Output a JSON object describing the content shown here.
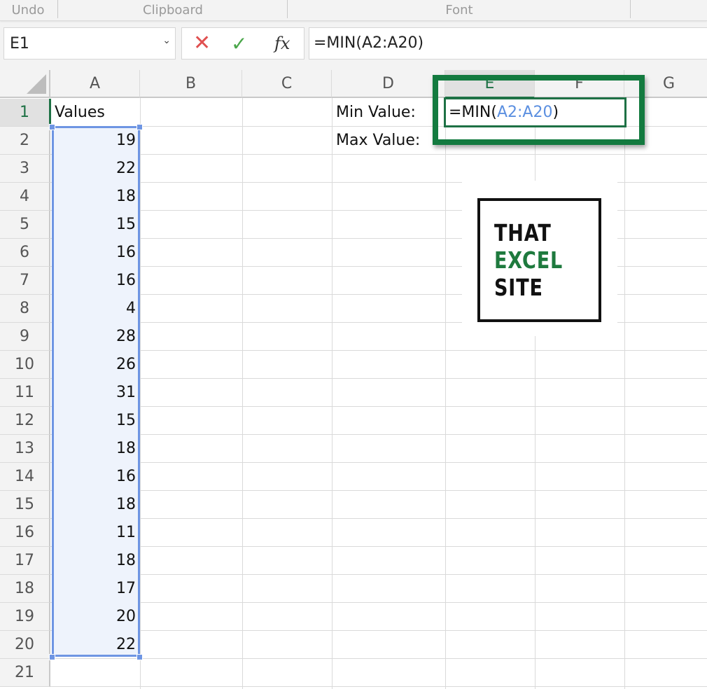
{
  "ribbon": {
    "groups": [
      "Undo",
      "Clipboard",
      "Font"
    ]
  },
  "name_box": {
    "value": "E1"
  },
  "formula_bar": {
    "cancel_icon": "x-icon",
    "enter_icon": "check-icon",
    "fx_label": "fx",
    "value": "=MIN(A2:A20)"
  },
  "columns": [
    "A",
    "B",
    "C",
    "D",
    "E",
    "F",
    "G"
  ],
  "rows": [
    "1",
    "2",
    "3",
    "4",
    "5",
    "6",
    "7",
    "8",
    "9",
    "10",
    "11",
    "12",
    "13",
    "14",
    "15",
    "16",
    "17",
    "18",
    "19",
    "20",
    "21"
  ],
  "cells": {
    "A1": "Values",
    "A_values": [
      "19",
      "22",
      "18",
      "15",
      "16",
      "16",
      "4",
      "28",
      "26",
      "31",
      "15",
      "18",
      "16",
      "18",
      "11",
      "18",
      "17",
      "20",
      "22"
    ],
    "D1": "Min Value:",
    "D2": "Max Value:"
  },
  "editing": {
    "cell": "E1",
    "prefix": "=MIN(",
    "range_ref": "A2:A20",
    "suffix": ")"
  },
  "logo": {
    "line1": "THAT",
    "line2": "EXCEL",
    "line3": "SITE"
  },
  "colors": {
    "accent_green": "#137a3f",
    "range_blue": "#6e95e3"
  }
}
